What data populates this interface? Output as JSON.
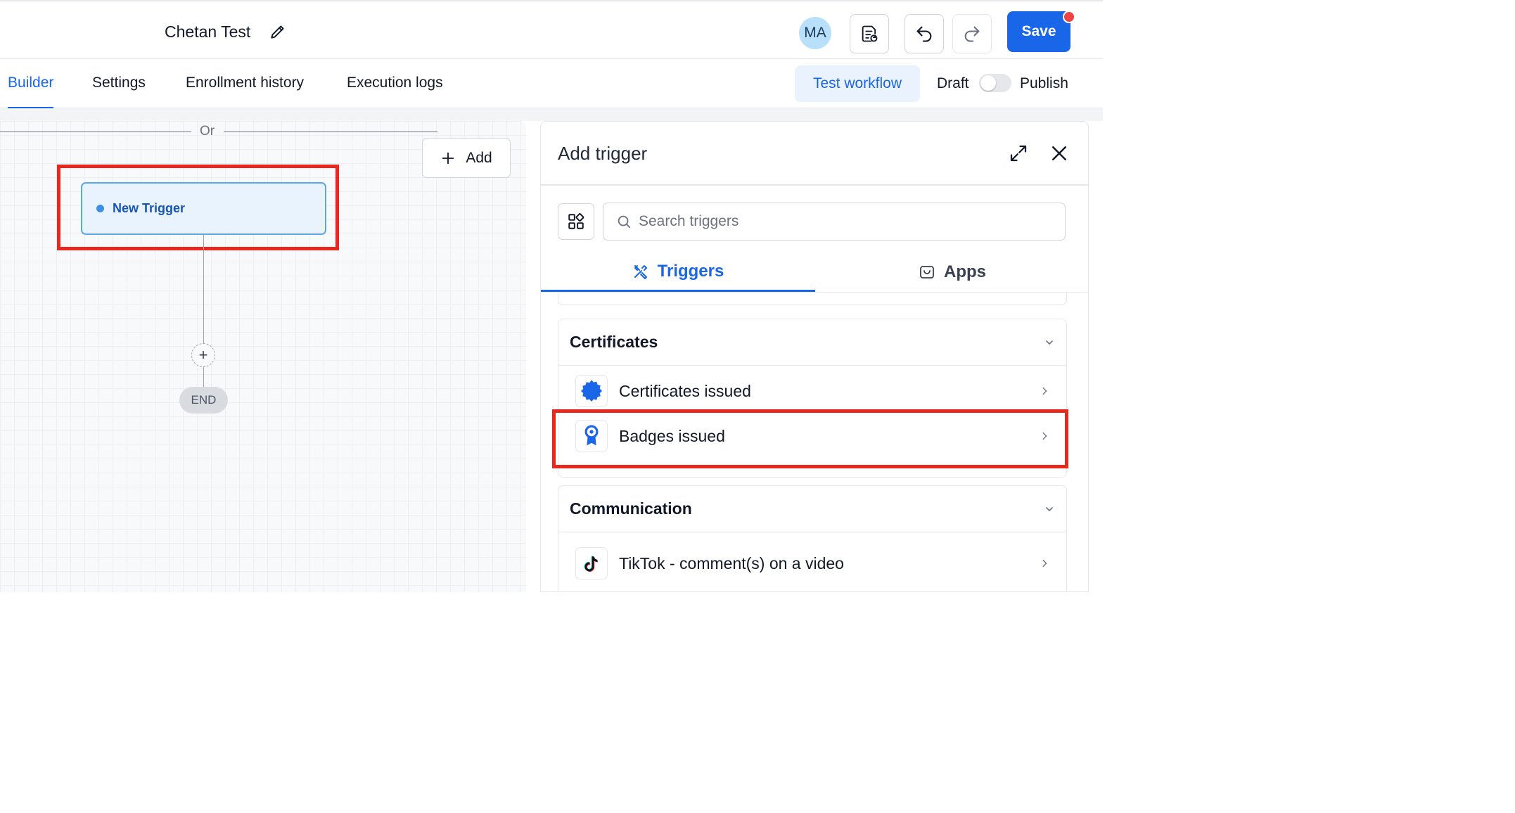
{
  "header": {
    "workflow_title": "Chetan Test",
    "avatar_initials": "MA",
    "save_label": "Save"
  },
  "tabs": [
    {
      "label": "Builder",
      "active": true
    },
    {
      "label": "Settings"
    },
    {
      "label": "Enrollment history"
    },
    {
      "label": "Execution logs"
    }
  ],
  "actions": {
    "test_workflow_label": "Test workflow",
    "draft_label": "Draft",
    "publish_label": "Publish"
  },
  "canvas": {
    "or_label": "Or",
    "add_label": "Add",
    "trigger_node_label": "New Trigger",
    "end_label": "END"
  },
  "panel": {
    "title": "Add trigger",
    "search_placeholder": "Search triggers",
    "tabs": [
      {
        "label": "Triggers",
        "active": true
      },
      {
        "label": "Apps"
      }
    ],
    "sections": [
      {
        "title": "Certificates",
        "items": [
          {
            "label": "Certificates issued",
            "icon": "certificate-badge-icon"
          },
          {
            "label": "Badges issued",
            "icon": "ribbon-badge-icon"
          }
        ]
      },
      {
        "title": "Communication",
        "items": [
          {
            "label": "TikTok - comment(s) on a video",
            "icon": "tiktok-icon"
          }
        ]
      }
    ]
  },
  "colors": {
    "accent": "#1a66e8",
    "highlight": "#e8281e",
    "notification_dot": "#ef4444"
  }
}
